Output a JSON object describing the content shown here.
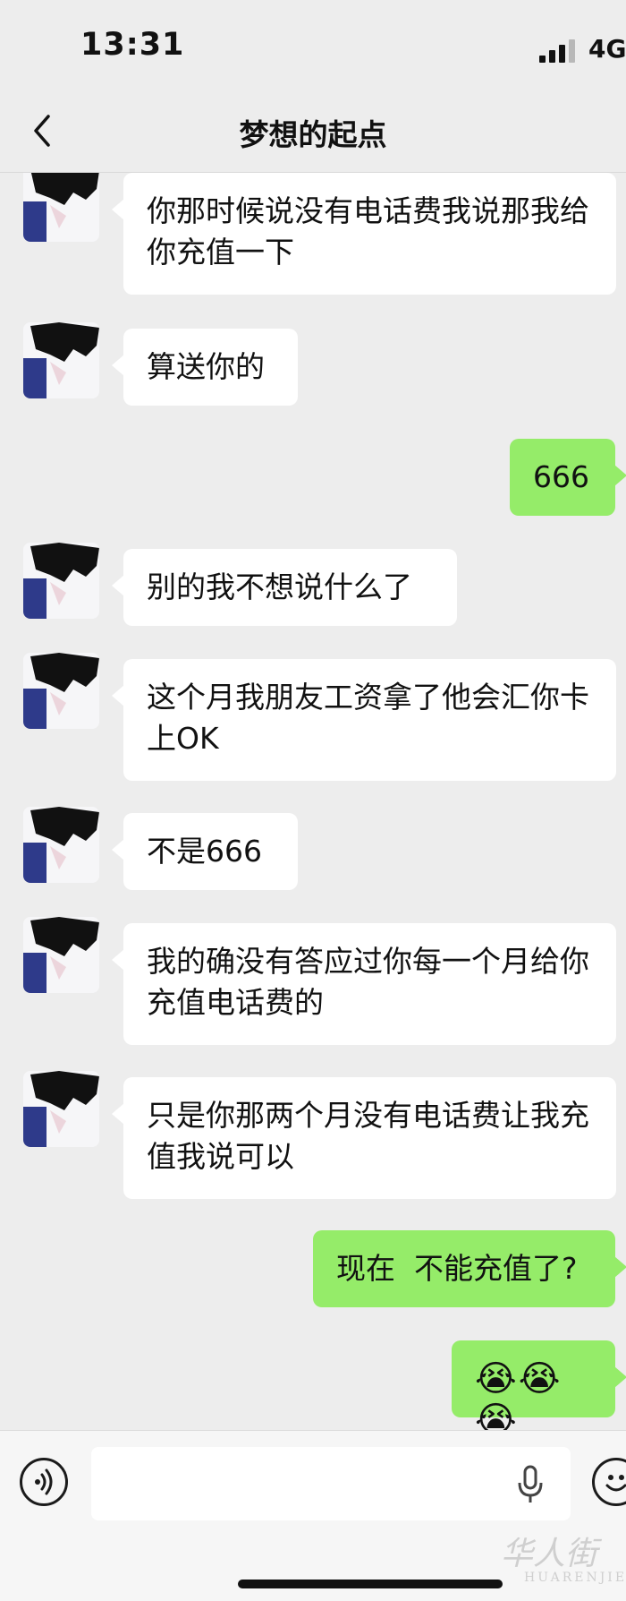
{
  "status_bar": {
    "time": "13:31",
    "network": "4G"
  },
  "header": {
    "title": "梦想的起点"
  },
  "messages": [
    {
      "side": "left",
      "text": "你那时候说没有电话费我说那我给你充值一下"
    },
    {
      "side": "left",
      "text": "算送你的"
    },
    {
      "side": "right",
      "text": "666"
    },
    {
      "side": "left",
      "text": "别的我不想说什么了"
    },
    {
      "side": "left",
      "text": "这个月我朋友工资拿了他会汇你卡上OK"
    },
    {
      "side": "left",
      "text": "不是666"
    },
    {
      "side": "left",
      "text": "我的确没有答应过你每一个月给你充值电话费的"
    },
    {
      "side": "left",
      "text": "只是你那两个月没有电话费让我充值我说可以"
    },
    {
      "side": "right",
      "text": "现在  不能充值了?"
    },
    {
      "side": "right",
      "text": "😭😭😭"
    }
  ],
  "input": {
    "value": ""
  },
  "watermark": {
    "text": "华人街",
    "latin": "HUARENJIE"
  }
}
